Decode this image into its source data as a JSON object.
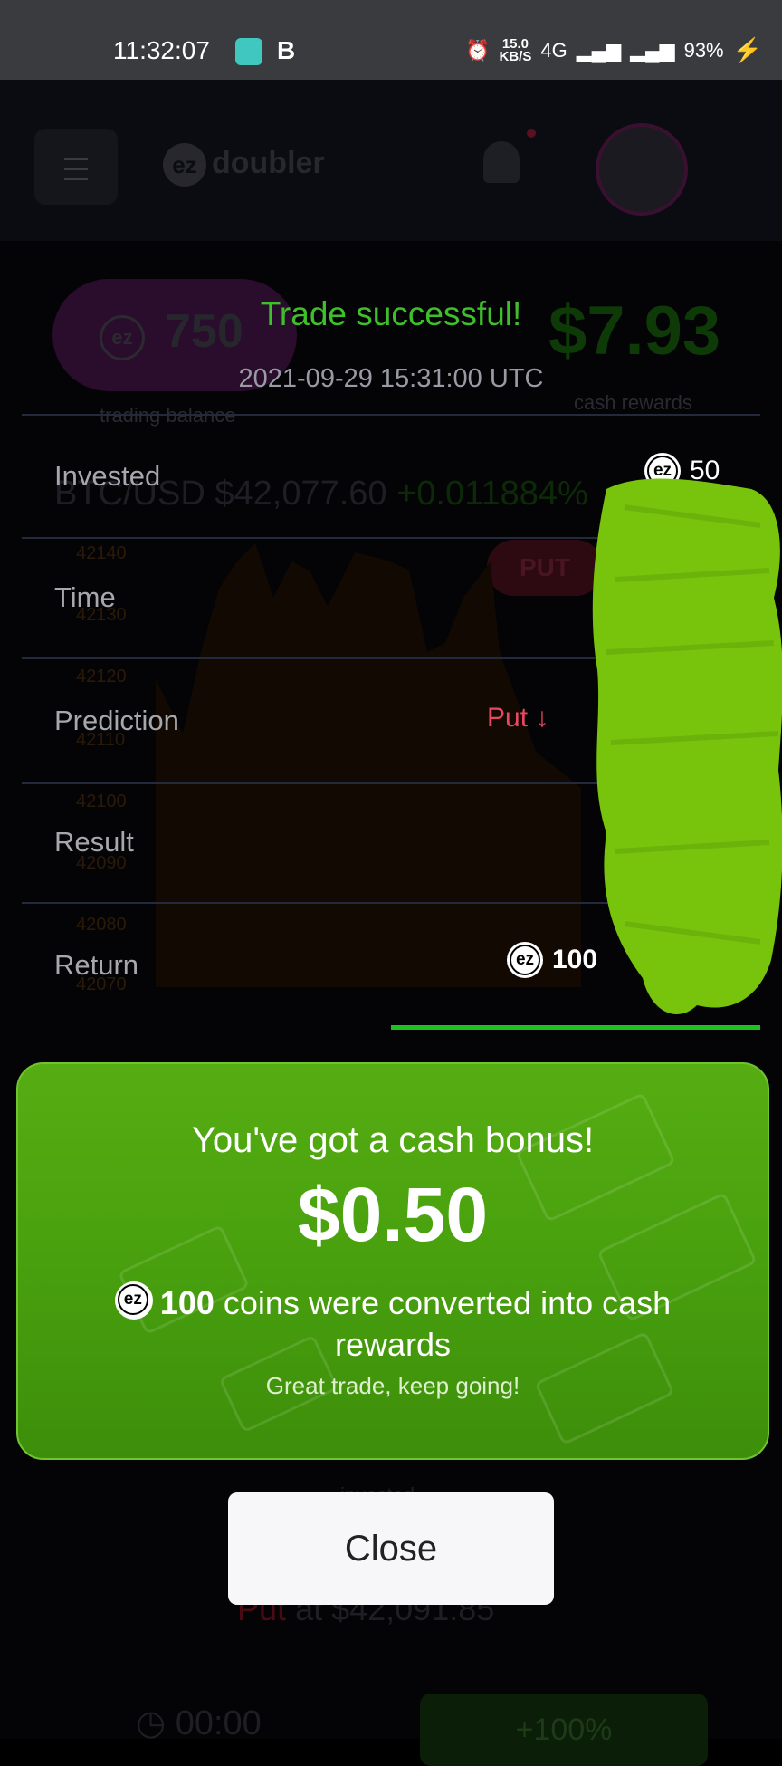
{
  "status_bar": {
    "time": "11:32:07",
    "btc_glyph": "B",
    "speed_value": "15.0",
    "speed_unit": "KB/S",
    "network": "4G",
    "battery": "93%"
  },
  "background": {
    "logo_text": "doubler",
    "logo_badge": "ez",
    "trading_balance": "750",
    "trading_balance_label": "trading balance",
    "cash_rewards": "$7.93",
    "cash_rewards_label": "cash rewards",
    "pair": "BTC/USD",
    "price": "$42,077.60",
    "change": "+0.011884%",
    "put_label": "PUT",
    "y_ticks": [
      "42140",
      "42130",
      "42120",
      "42110",
      "42100",
      "42090",
      "42080",
      "42070"
    ],
    "invested_label": "invested",
    "put_at_prefix": "Put",
    "put_at_value": "at $42,091.85",
    "timer": "00:00",
    "bonus_pct": "+100%"
  },
  "trade": {
    "title": "Trade successful!",
    "date": "2021-09-29 15:31:00 UTC",
    "rows": [
      {
        "label": "Invested",
        "value": "50"
      },
      {
        "label": "Time",
        "value": ""
      },
      {
        "label": "Prediction",
        "value": "Put ↓"
      },
      {
        "label": "Result",
        "value": ""
      },
      {
        "label": "Return",
        "value": "100"
      }
    ]
  },
  "bonus": {
    "title": "You've got a cash bonus!",
    "amount": "$0.50",
    "coins": "100",
    "message": "coins were converted into cash rewards",
    "subtitle": "Great trade, keep going!"
  },
  "close_label": "Close",
  "colors": {
    "success_green": "#3fbf2b",
    "put_red": "#e8495f",
    "bonus_green": "#4ea511",
    "redaction_green": "#78c40d"
  }
}
